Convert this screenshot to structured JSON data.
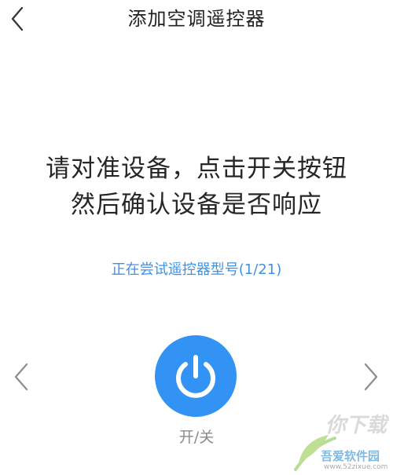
{
  "header": {
    "back_icon": "chevron-left-icon",
    "title": "添加空调遥控器"
  },
  "instruction": {
    "line1": "请对准设备，点击开关按钮",
    "line2": "然后确认设备是否响应"
  },
  "status": {
    "text": "正在尝试遥控器型号(1/21)"
  },
  "controls": {
    "prev_icon": "chevron-left-icon",
    "next_icon": "chevron-right-icon",
    "power_icon": "power-icon",
    "power_label": "开/关"
  },
  "watermark": {
    "name": "吾爱软件园",
    "url": "www.52zixue.com"
  },
  "colors": {
    "accent": "#3293f4",
    "status_text": "#3d92e6",
    "title_text": "#222222",
    "label_text": "#8a8a8a"
  }
}
